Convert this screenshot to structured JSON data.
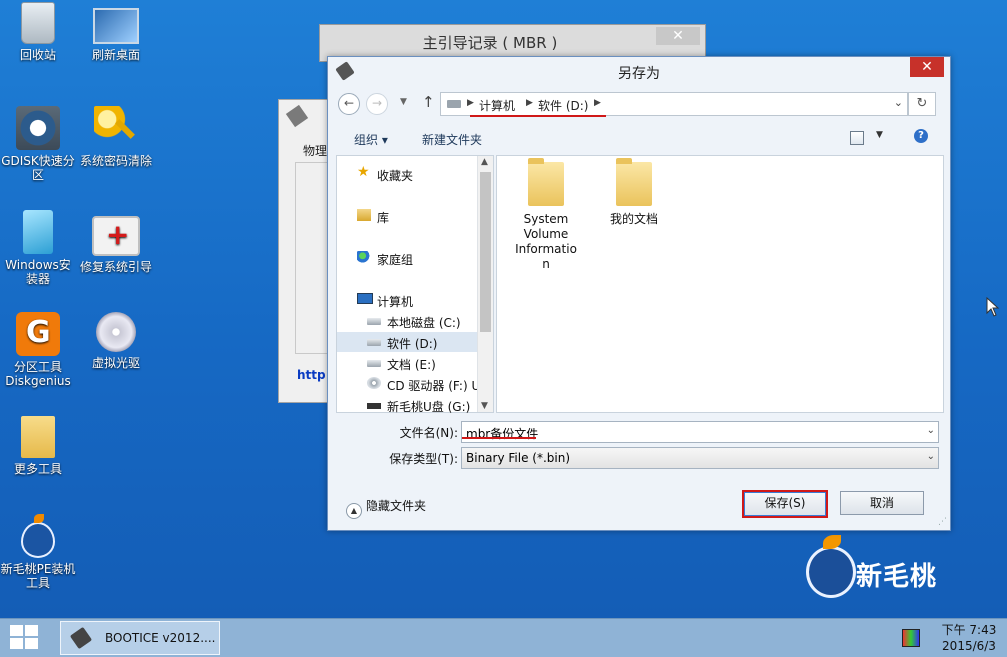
{
  "desktop": {
    "icons": [
      {
        "label": "回收站"
      },
      {
        "label": "刷新桌面"
      },
      {
        "label": "GDISK快速分区"
      },
      {
        "label": "系统密码清除"
      },
      {
        "label": "Windows安装器"
      },
      {
        "label": "修复系统引导"
      },
      {
        "label": "分区工具Diskgenius"
      },
      {
        "label": "虚拟光驱"
      },
      {
        "label": "更多工具"
      },
      {
        "label": "新毛桃PE装机工具"
      }
    ],
    "brand": "新毛桃"
  },
  "mbr_window": {
    "title": "主引导记录 ( MBR )",
    "close": "✕"
  },
  "boot_window": {
    "side_label": "物理",
    "link": "http"
  },
  "dialog": {
    "title": "另存为",
    "close": "✕",
    "breadcrumbs": [
      "计算机",
      "软件 (D:)"
    ],
    "toolbar": {
      "organize": "组织 ▾",
      "new_folder": "新建文件夹"
    },
    "nav": [
      {
        "label": "收藏夹",
        "icon": "star-icon"
      },
      {
        "label": "库",
        "icon": "library-icon"
      },
      {
        "label": "家庭组",
        "icon": "homegroup-icon"
      },
      {
        "label": "计算机",
        "icon": "computer-icon"
      },
      {
        "label": "本地磁盘 (C:)",
        "icon": "drive-icon"
      },
      {
        "label": "软件 (D:)",
        "icon": "drive-icon",
        "selected": true
      },
      {
        "label": "文档 (E:)",
        "icon": "drive-icon"
      },
      {
        "label": "CD 驱动器 (F:) U",
        "icon": "cd-icon"
      },
      {
        "label": "新毛桃U盘 (G:)",
        "icon": "usb-icon"
      }
    ],
    "files": [
      {
        "name": "System Volume Informatio n"
      },
      {
        "name": "我的文档"
      }
    ],
    "filename_label": "文件名(N):",
    "filename_value": "mbr备份文件",
    "filetype_label": "保存类型(T):",
    "filetype_value": "Binary File (*.bin)",
    "hide_folders": "隐藏文件夹",
    "save": "保存(S)",
    "cancel": "取消"
  },
  "taskbar": {
    "app": "BOOTICE v2012....",
    "time": "下午 7:43",
    "date": "2015/6/3"
  },
  "colors": {
    "highlight": "#d01818",
    "desktop": "#1a72c9",
    "close": "#c7312a"
  }
}
